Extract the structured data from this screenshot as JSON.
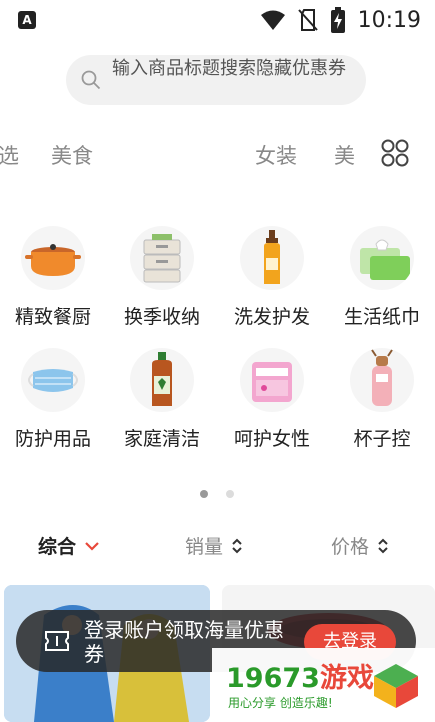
{
  "status_bar": {
    "time": "10:19",
    "badge": "A"
  },
  "search": {
    "placeholder": "输入商品标题搜索隐藏优惠券"
  },
  "tabs": [
    "选",
    "美食",
    "女装",
    "美"
  ],
  "categories": [
    {
      "label": "精致餐厨",
      "icon": "pot-icon"
    },
    {
      "label": "换季收纳",
      "icon": "storage-box-icon"
    },
    {
      "label": "洗发护发",
      "icon": "shampoo-icon"
    },
    {
      "label": "生活纸巾",
      "icon": "tissue-icon"
    },
    {
      "label": "防护用品",
      "icon": "mask-icon"
    },
    {
      "label": "家庭清洁",
      "icon": "disinfectant-icon"
    },
    {
      "label": "呵护女性",
      "icon": "pad-icon"
    },
    {
      "label": "杯子控",
      "icon": "cup-icon"
    }
  ],
  "pager": {
    "active": 1,
    "total": 2
  },
  "sort": {
    "comprehensive": "综合",
    "sales": "销量",
    "price": "价格"
  },
  "toast": {
    "text": "登录账户领取海量优惠券",
    "button": "去登录"
  },
  "watermark": {
    "number": "19673",
    "suffix": "游戏",
    "slogan": "用心分享 创造乐趣!"
  },
  "colors": {
    "accent": "#e8483a",
    "watermark_green": "#2a9a2a"
  }
}
